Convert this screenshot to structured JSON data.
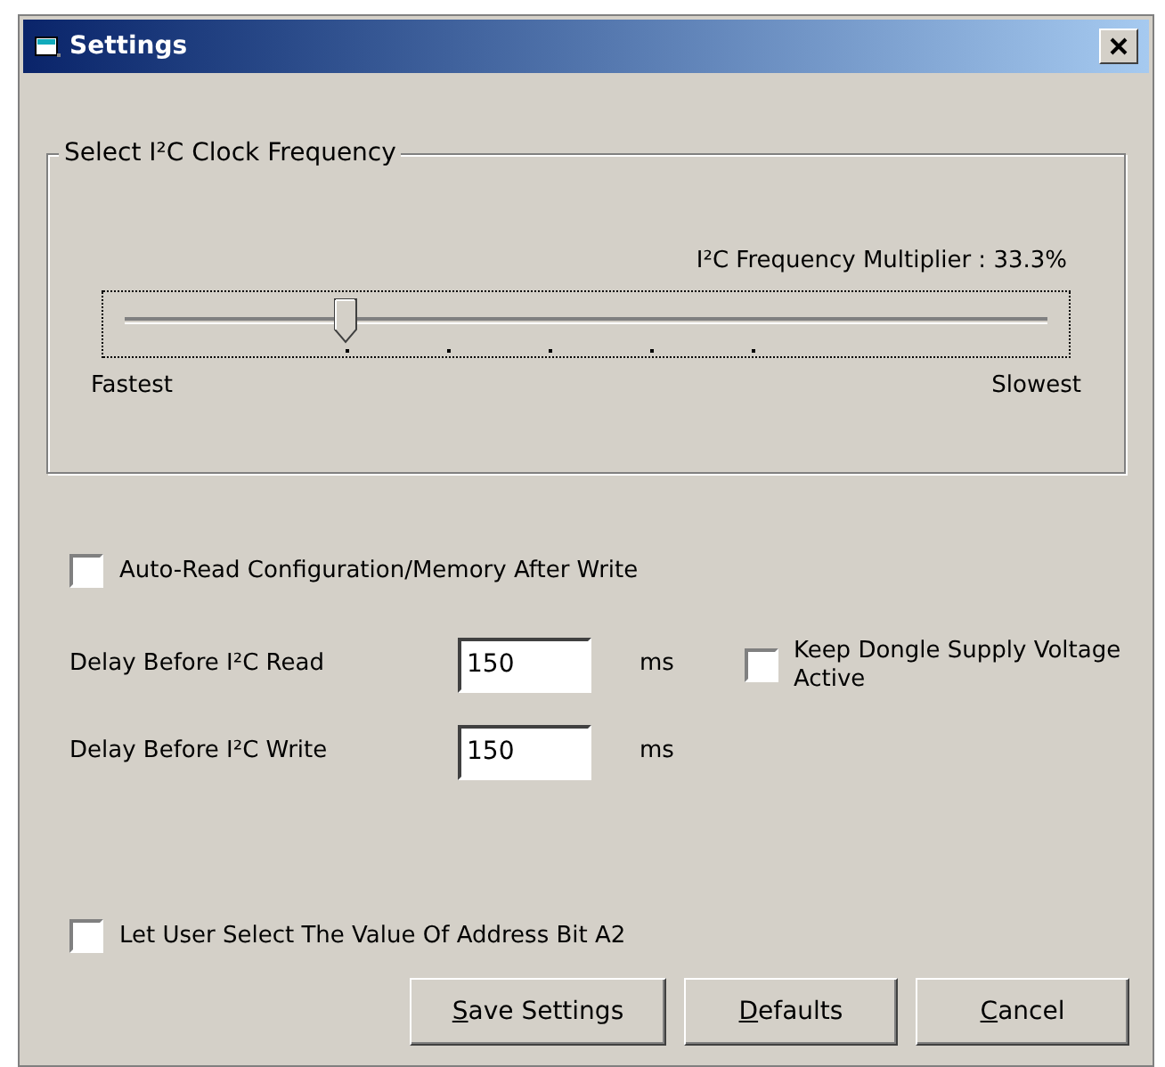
{
  "window": {
    "title": "Settings"
  },
  "frequency_group": {
    "title": "Select I²C Clock Frequency",
    "multiplier_label": "I²C Frequency Multiplier : 33.3%",
    "slider": {
      "level": 0.24
    },
    "min_label": "Fastest",
    "max_label": "Slowest"
  },
  "auto_read": {
    "label": "Auto-Read Configuration/Memory After Write",
    "checked": false
  },
  "delays": [
    {
      "label": "Delay Before I²C Read",
      "value": "150",
      "unit": "ms"
    },
    {
      "label": "Delay Before I²C Write",
      "value": "150",
      "unit": "ms"
    }
  ],
  "keep_supply": {
    "label": "Keep Dongle Supply Voltage Active",
    "checked": false
  },
  "select_a2": {
    "label": "Let User Select The Value Of Address Bit A2",
    "checked": false
  },
  "buttons": [
    {
      "access_key": "S",
      "label_rest": "ave Settings"
    },
    {
      "access_key": "D",
      "label_rest": "efaults"
    },
    {
      "access_key": "C",
      "label_rest": "ancel"
    }
  ]
}
